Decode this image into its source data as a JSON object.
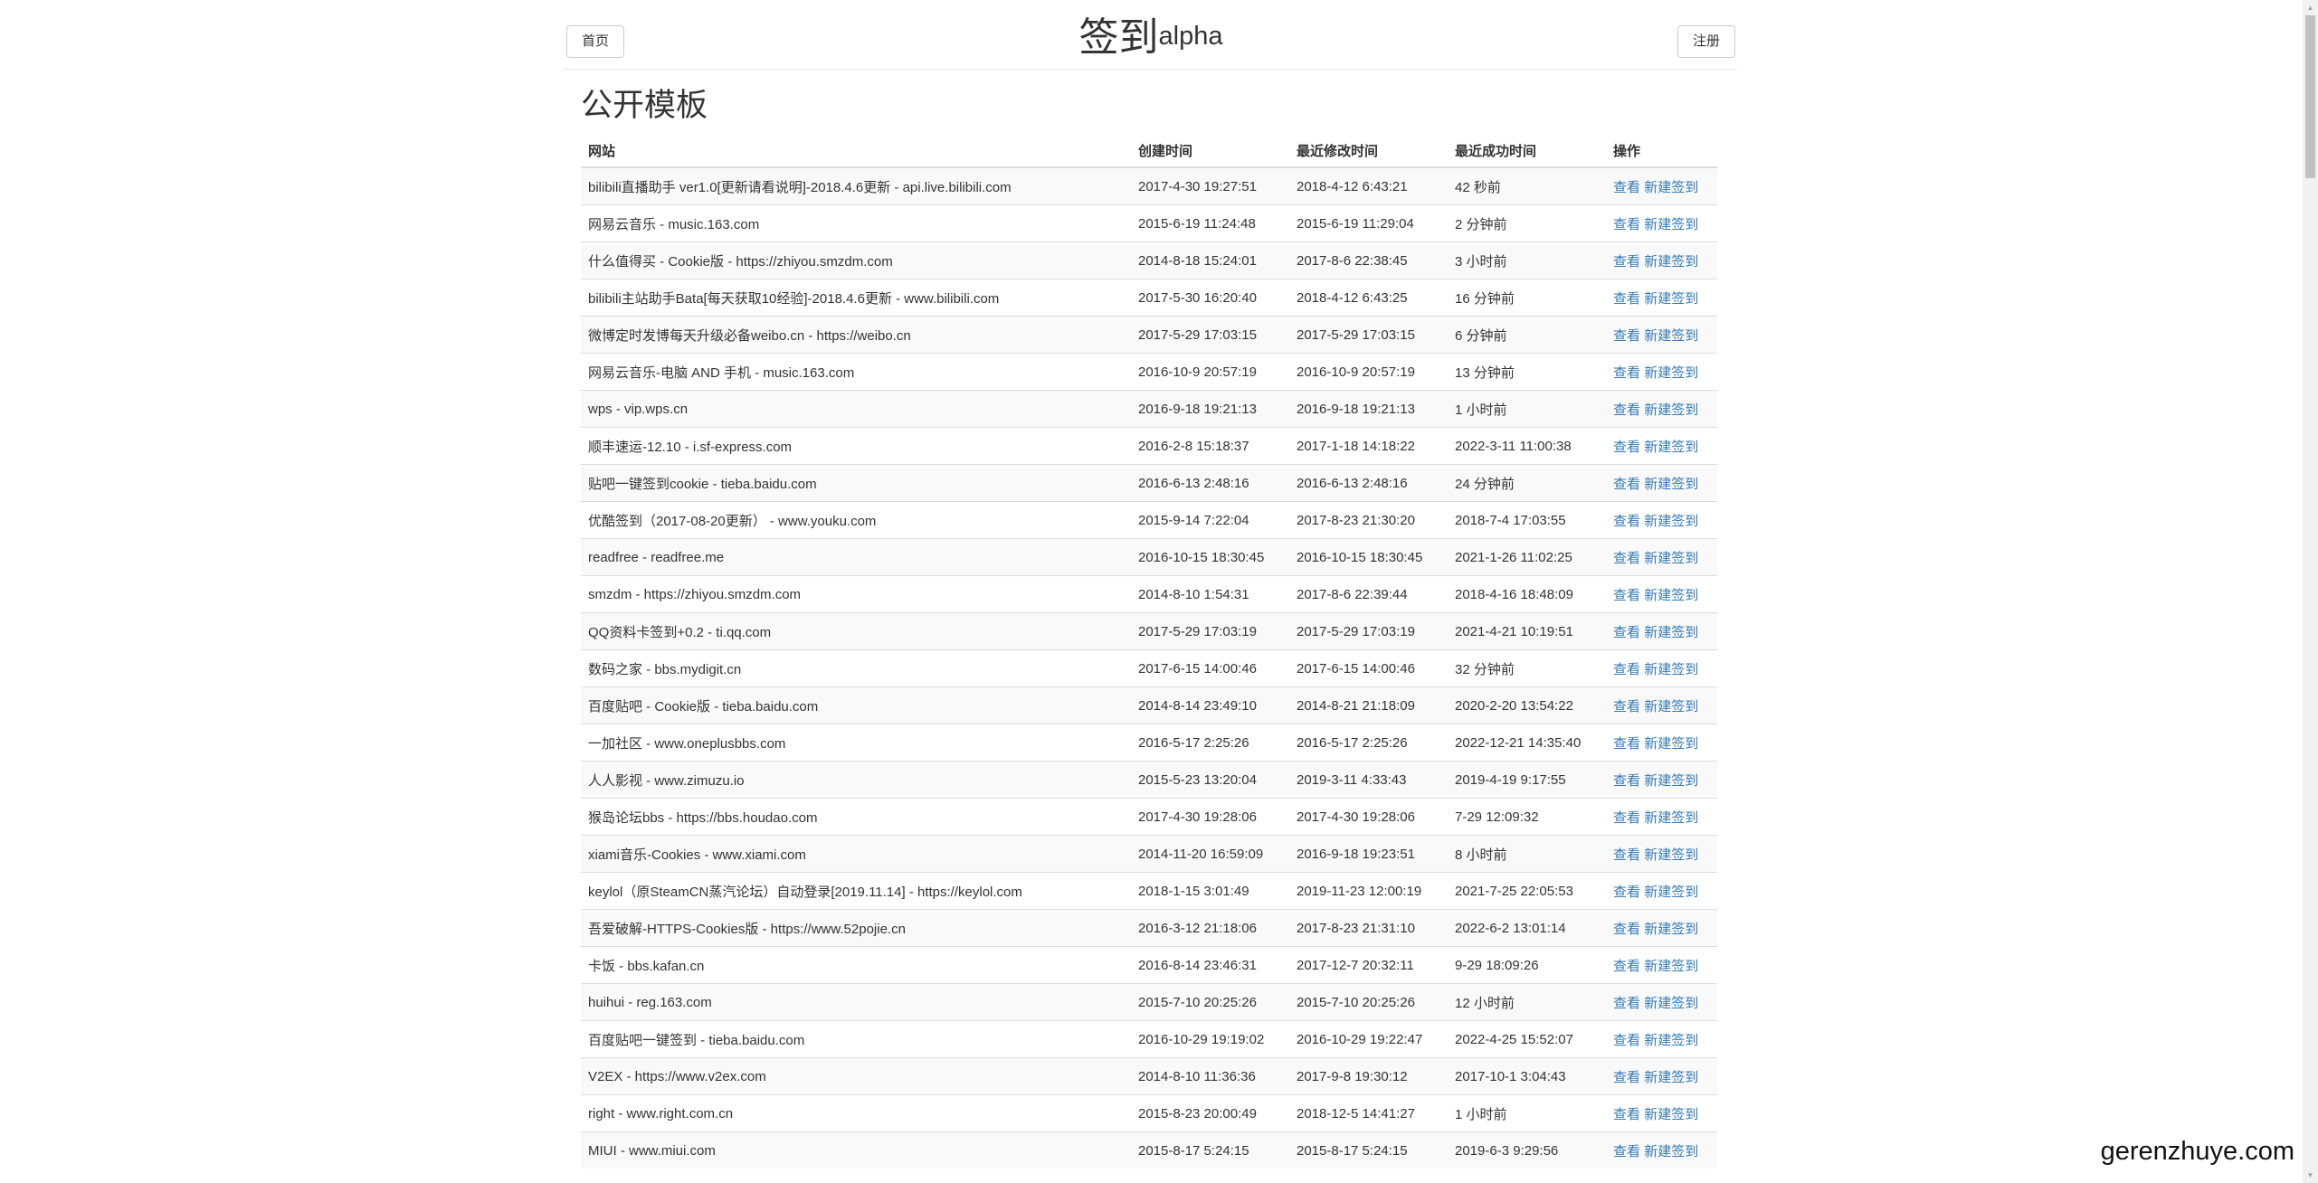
{
  "header": {
    "home_label": "首页",
    "title": "签到",
    "title_sup": "alpha",
    "register_label": "注册"
  },
  "section_title": "公开模板",
  "table": {
    "columns": [
      "网站",
      "创建时间",
      "最近修改时间",
      "最近成功时间",
      "操作"
    ],
    "view_label": "查看",
    "new_label": "新建签到",
    "rows": [
      {
        "site": "bilibili直播助手 ver1.0[更新请看说明]-2018.4.6更新 - api.live.bilibili.com",
        "created": "2017-4-30 19:27:51",
        "modified": "2018-4-12 6:43:21",
        "success": "42 秒前"
      },
      {
        "site": "网易云音乐 - music.163.com",
        "created": "2015-6-19 11:24:48",
        "modified": "2015-6-19 11:29:04",
        "success": "2 分钟前"
      },
      {
        "site": "什么值得买 - Cookie版 - https://zhiyou.smzdm.com",
        "created": "2014-8-18 15:24:01",
        "modified": "2017-8-6 22:38:45",
        "success": "3 小时前"
      },
      {
        "site": "bilibili主站助手Bata[每天获取10经验]-2018.4.6更新 - www.bilibili.com",
        "created": "2017-5-30 16:20:40",
        "modified": "2018-4-12 6:43:25",
        "success": "16 分钟前"
      },
      {
        "site": "微博定时发博每天升级必备weibo.cn - https://weibo.cn",
        "created": "2017-5-29 17:03:15",
        "modified": "2017-5-29 17:03:15",
        "success": "6 分钟前"
      },
      {
        "site": "网易云音乐-电脑 AND 手机 - music.163.com",
        "created": "2016-10-9 20:57:19",
        "modified": "2016-10-9 20:57:19",
        "success": "13 分钟前"
      },
      {
        "site": "wps - vip.wps.cn",
        "created": "2016-9-18 19:21:13",
        "modified": "2016-9-18 19:21:13",
        "success": "1 小时前"
      },
      {
        "site": "顺丰速运-12.10 - i.sf-express.com",
        "created": "2016-2-8 15:18:37",
        "modified": "2017-1-18 14:18:22",
        "success": "2022-3-11 11:00:38"
      },
      {
        "site": "贴吧一键签到cookie - tieba.baidu.com",
        "created": "2016-6-13 2:48:16",
        "modified": "2016-6-13 2:48:16",
        "success": "24 分钟前"
      },
      {
        "site": "优酷签到（2017-08-20更新） - www.youku.com",
        "created": "2015-9-14 7:22:04",
        "modified": "2017-8-23 21:30:20",
        "success": "2018-7-4 17:03:55"
      },
      {
        "site": "readfree - readfree.me",
        "created": "2016-10-15 18:30:45",
        "modified": "2016-10-15 18:30:45",
        "success": "2021-1-26 11:02:25"
      },
      {
        "site": "smzdm - https://zhiyou.smzdm.com",
        "created": "2014-8-10 1:54:31",
        "modified": "2017-8-6 22:39:44",
        "success": "2018-4-16 18:48:09"
      },
      {
        "site": "QQ资料卡签到+0.2 - ti.qq.com",
        "created": "2017-5-29 17:03:19",
        "modified": "2017-5-29 17:03:19",
        "success": "2021-4-21 10:19:51"
      },
      {
        "site": "数码之家 - bbs.mydigit.cn",
        "created": "2017-6-15 14:00:46",
        "modified": "2017-6-15 14:00:46",
        "success": "32 分钟前"
      },
      {
        "site": "百度贴吧 - Cookie版 - tieba.baidu.com",
        "created": "2014-8-14 23:49:10",
        "modified": "2014-8-21 21:18:09",
        "success": "2020-2-20 13:54:22"
      },
      {
        "site": "一加社区 - www.oneplusbbs.com",
        "created": "2016-5-17 2:25:26",
        "modified": "2016-5-17 2:25:26",
        "success": "2022-12-21 14:35:40"
      },
      {
        "site": "人人影视 - www.zimuzu.io",
        "created": "2015-5-23 13:20:04",
        "modified": "2019-3-11 4:33:43",
        "success": "2019-4-19 9:17:55"
      },
      {
        "site": "猴岛论坛bbs - https://bbs.houdao.com",
        "created": "2017-4-30 19:28:06",
        "modified": "2017-4-30 19:28:06",
        "success": "7-29 12:09:32"
      },
      {
        "site": "xiami音乐-Cookies - www.xiami.com",
        "created": "2014-11-20 16:59:09",
        "modified": "2016-9-18 19:23:51",
        "success": "8 小时前"
      },
      {
        "site": "keylol（原SteamCN蒸汽论坛）自动登录[2019.11.14] - https://keylol.com",
        "created": "2018-1-15 3:01:49",
        "modified": "2019-11-23 12:00:19",
        "success": "2021-7-25 22:05:53"
      },
      {
        "site": "吾爱破解-HTTPS-Cookies版 - https://www.52pojie.cn",
        "created": "2016-3-12 21:18:06",
        "modified": "2017-8-23 21:31:10",
        "success": "2022-6-2 13:01:14"
      },
      {
        "site": "卡饭 - bbs.kafan.cn",
        "created": "2016-8-14 23:46:31",
        "modified": "2017-12-7 20:32:11",
        "success": "9-29 18:09:26"
      },
      {
        "site": "huihui - reg.163.com",
        "created": "2015-7-10 20:25:26",
        "modified": "2015-7-10 20:25:26",
        "success": "12 小时前"
      },
      {
        "site": "百度贴吧一键签到 - tieba.baidu.com",
        "created": "2016-10-29 19:19:02",
        "modified": "2016-10-29 19:22:47",
        "success": "2022-4-25 15:52:07"
      },
      {
        "site": "V2EX - https://www.v2ex.com",
        "created": "2014-8-10 11:36:36",
        "modified": "2017-9-8 19:30:12",
        "success": "2017-10-1 3:04:43"
      },
      {
        "site": "right - www.right.com.cn",
        "created": "2015-8-23 20:00:49",
        "modified": "2018-12-5 14:41:27",
        "success": "1 小时前"
      },
      {
        "site": "MIUI - www.miui.com",
        "created": "2015-8-17 5:24:15",
        "modified": "2015-8-17 5:24:15",
        "success": "2019-6-3 9:29:56"
      }
    ]
  },
  "watermark": "gerenzhuye.com"
}
